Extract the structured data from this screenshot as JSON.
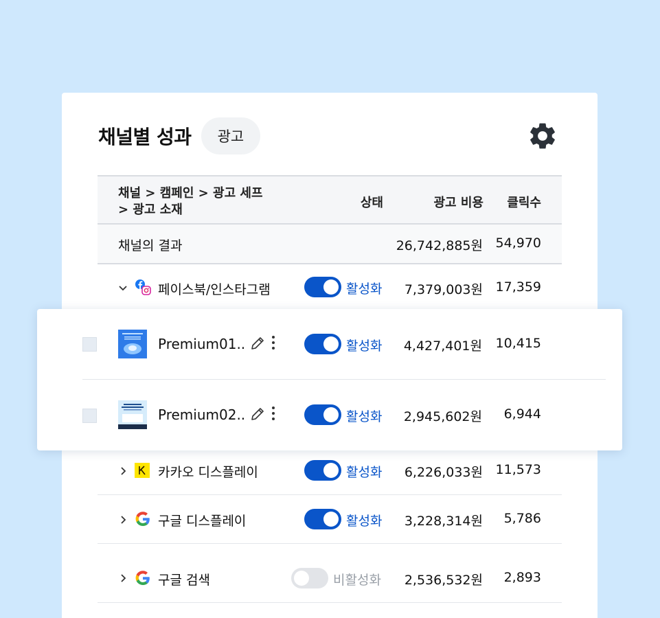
{
  "card": {
    "title": "채널별 성과",
    "badge": "광고"
  },
  "table": {
    "headers": {
      "channel_line1": "채널 > 캠페인 > 광고 세프",
      "channel_line2": "> 광고 소재",
      "status": "상태",
      "cost": "광고 비용",
      "clicks": "클릭수"
    },
    "summary": {
      "label": "채널의 결과",
      "cost": "26,742,885원",
      "clicks": "54,970"
    },
    "channels": [
      {
        "name": "페이스북/인스타그램",
        "icon": "facebook-instagram-icon",
        "expanded": true,
        "status": "활성화",
        "active": true,
        "cost": "7,379,003원",
        "clicks": "17,359"
      },
      {
        "name": "카카오 디스플레이",
        "icon": "kakao-icon",
        "expanded": false,
        "status": "활성화",
        "active": true,
        "cost": "6,226,033원",
        "clicks": "11,573"
      },
      {
        "name": "구글 디스플레이",
        "icon": "google-icon",
        "expanded": false,
        "status": "활성화",
        "active": true,
        "cost": "3,228,314원",
        "clicks": "5,786"
      },
      {
        "name": "구글 검색",
        "icon": "google-icon",
        "expanded": false,
        "status": "비활성화",
        "active": false,
        "cost": "2,536,532원",
        "clicks": "2,893"
      }
    ],
    "ads": [
      {
        "name": "Premium01..",
        "status": "활성화",
        "active": true,
        "cost": "4,427,401원",
        "clicks": "10,415"
      },
      {
        "name": "Premium02..",
        "status": "활성화",
        "active": true,
        "cost": "2,945,602원",
        "clicks": "6,944"
      }
    ]
  },
  "colors": {
    "accent": "#0a55c9",
    "background": "#cfe8fd",
    "inactive_text": "#9aa0a8",
    "kakao_yellow": "#fee500"
  }
}
